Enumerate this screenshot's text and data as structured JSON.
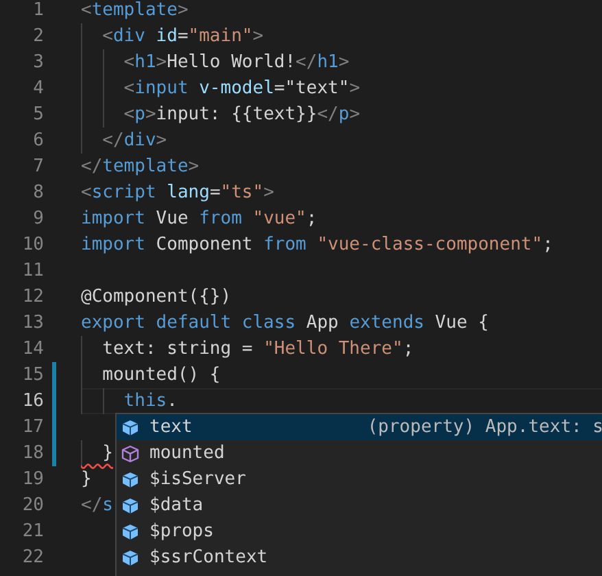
{
  "editor": {
    "lines": [
      {
        "number": "1",
        "tokens": [
          {
            "kind": "bracket",
            "text": "<"
          },
          {
            "kind": "tag",
            "text": "template"
          },
          {
            "kind": "bracket",
            "text": ">"
          }
        ]
      },
      {
        "number": "2",
        "tokens": [
          {
            "kind": "bracket",
            "text": "  <"
          },
          {
            "kind": "tag",
            "text": "div"
          },
          {
            "kind": "attr",
            "text": " id"
          },
          {
            "kind": "text",
            "text": "="
          },
          {
            "kind": "string",
            "text": "\"main\""
          },
          {
            "kind": "bracket",
            "text": ">"
          }
        ]
      },
      {
        "number": "3",
        "tokens": [
          {
            "kind": "bracket",
            "text": "    <"
          },
          {
            "kind": "tag",
            "text": "h1"
          },
          {
            "kind": "bracket",
            "text": ">"
          },
          {
            "kind": "text",
            "text": "Hello World!"
          },
          {
            "kind": "bracket",
            "text": "</"
          },
          {
            "kind": "tag",
            "text": "h1"
          },
          {
            "kind": "bracket",
            "text": ">"
          }
        ]
      },
      {
        "number": "4",
        "tokens": [
          {
            "kind": "bracket",
            "text": "    <"
          },
          {
            "kind": "tag",
            "text": "input"
          },
          {
            "kind": "attr",
            "text": " v-model"
          },
          {
            "kind": "text",
            "text": "=\"text\""
          },
          {
            "kind": "bracket",
            "text": ">"
          }
        ]
      },
      {
        "number": "5",
        "tokens": [
          {
            "kind": "bracket",
            "text": "    <"
          },
          {
            "kind": "tag",
            "text": "p"
          },
          {
            "kind": "bracket",
            "text": ">"
          },
          {
            "kind": "text",
            "text": "input: {{text}}"
          },
          {
            "kind": "bracket",
            "text": "</"
          },
          {
            "kind": "tag",
            "text": "p"
          },
          {
            "kind": "bracket",
            "text": ">"
          }
        ]
      },
      {
        "number": "6",
        "tokens": [
          {
            "kind": "bracket",
            "text": "  </"
          },
          {
            "kind": "tag",
            "text": "div"
          },
          {
            "kind": "bracket",
            "text": ">"
          }
        ]
      },
      {
        "number": "7",
        "tokens": [
          {
            "kind": "bracket",
            "text": "</"
          },
          {
            "kind": "tag",
            "text": "template"
          },
          {
            "kind": "bracket",
            "text": ">"
          }
        ]
      },
      {
        "number": "8",
        "tokens": [
          {
            "kind": "bracket",
            "text": "<"
          },
          {
            "kind": "tag",
            "text": "script"
          },
          {
            "kind": "attr",
            "text": " lang"
          },
          {
            "kind": "text",
            "text": "="
          },
          {
            "kind": "string",
            "text": "\"ts\""
          },
          {
            "kind": "bracket",
            "text": ">"
          }
        ]
      },
      {
        "number": "9",
        "tokens": [
          {
            "kind": "keyword",
            "text": "import"
          },
          {
            "kind": "text",
            "text": " Vue "
          },
          {
            "kind": "keyword",
            "text": "from"
          },
          {
            "kind": "string",
            "text": " \"vue\""
          },
          {
            "kind": "text",
            "text": ";"
          }
        ]
      },
      {
        "number": "10",
        "tokens": [
          {
            "kind": "keyword",
            "text": "import"
          },
          {
            "kind": "text",
            "text": " Component "
          },
          {
            "kind": "keyword",
            "text": "from"
          },
          {
            "kind": "string",
            "text": " \"vue-class-component\""
          },
          {
            "kind": "text",
            "text": ";"
          }
        ]
      },
      {
        "number": "11"
      },
      {
        "number": "12",
        "tokens": [
          {
            "kind": "text",
            "text": "@Component({})"
          }
        ]
      },
      {
        "number": "13",
        "tokens": [
          {
            "kind": "keyword",
            "text": "export default class"
          },
          {
            "kind": "text",
            "text": " App "
          },
          {
            "kind": "keyword",
            "text": "extends"
          },
          {
            "kind": "text",
            "text": " Vue {"
          }
        ]
      },
      {
        "number": "14",
        "tokens": [
          {
            "kind": "text",
            "text": "  text: string = "
          },
          {
            "kind": "string",
            "text": "\"Hello There\""
          },
          {
            "kind": "text",
            "text": ";"
          }
        ]
      },
      {
        "number": "15",
        "modified": true,
        "tokens": [
          {
            "kind": "text",
            "text": "  mounted() {"
          }
        ]
      },
      {
        "number": "16",
        "modified": true,
        "current": true,
        "tokens": [
          {
            "kind": "keyword",
            "text": "    this"
          },
          {
            "kind": "text",
            "text": "."
          }
        ]
      },
      {
        "number": "17",
        "modified": true
      },
      {
        "number": "18",
        "modified": true,
        "tokens": [
          {
            "kind": "text",
            "text": "  }",
            "error": true
          }
        ]
      },
      {
        "number": "19",
        "tokens": [
          {
            "kind": "text",
            "text": "}"
          }
        ]
      },
      {
        "number": "20",
        "tokens": [
          {
            "kind": "bracket",
            "text": "</"
          },
          {
            "kind": "tag",
            "text": "s"
          }
        ]
      },
      {
        "number": "21"
      },
      {
        "number": "22"
      }
    ]
  },
  "suggestions": [
    {
      "kind": "property",
      "label": "text",
      "selected": true,
      "detail": "(property) App.text: s"
    },
    {
      "kind": "method",
      "label": "mounted",
      "selected": false
    },
    {
      "kind": "property",
      "label": "$isServer",
      "selected": false
    },
    {
      "kind": "property",
      "label": "$data",
      "selected": false
    },
    {
      "kind": "property",
      "label": "$props",
      "selected": false
    },
    {
      "kind": "property",
      "label": "$ssrContext",
      "selected": false
    }
  ]
}
